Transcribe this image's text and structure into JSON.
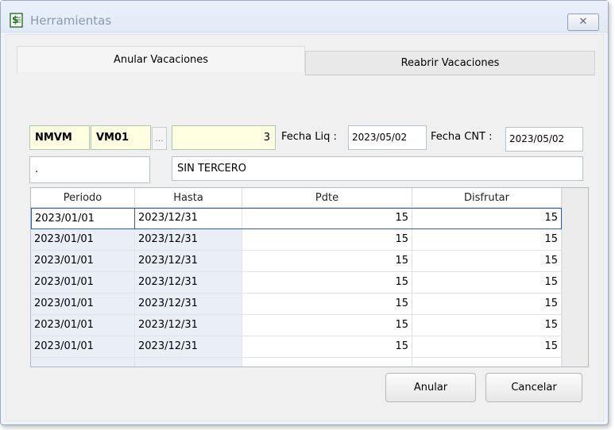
{
  "window": {
    "title": "Herramientas",
    "close_icon": "close-icon"
  },
  "tabs": [
    {
      "label": "Anular Vacaciones",
      "active": true
    },
    {
      "label": "Reabrir Vacaciones",
      "active": false
    }
  ],
  "form": {
    "code1": "NMVM",
    "code2": "VM01",
    "ellipsis": "...",
    "number": "3",
    "fecha_liq_label": "Fecha Liq :",
    "fecha_liq": "2023/05/02",
    "fecha_cnt_label": "Fecha CNT :",
    "fecha_cnt": "2023/05/02",
    "dot_field": ".",
    "tercero": "SIN TERCERO"
  },
  "grid": {
    "columns": [
      "Periodo",
      "Hasta",
      "Pdte",
      "Disfrutar"
    ],
    "rows": [
      [
        "2023/01/01",
        "2023/12/31",
        "15",
        "15"
      ],
      [
        "2023/01/01",
        "2023/12/31",
        "15",
        "15"
      ],
      [
        "2023/01/01",
        "2023/12/31",
        "15",
        "15"
      ],
      [
        "2023/01/01",
        "2023/12/31",
        "15",
        "15"
      ],
      [
        "2023/01/01",
        "2023/12/31",
        "15",
        "15"
      ],
      [
        "2023/01/01",
        "2023/12/31",
        "15",
        "15"
      ],
      [
        "2023/01/01",
        "2023/12/31",
        "15",
        "15"
      ]
    ]
  },
  "buttons": {
    "anular": "Anular",
    "cancelar": "Cancelar"
  },
  "colors": {
    "window_bg": "#eef3fa",
    "field_yellow": "#ffffe2",
    "selection": "#2a60b0"
  }
}
